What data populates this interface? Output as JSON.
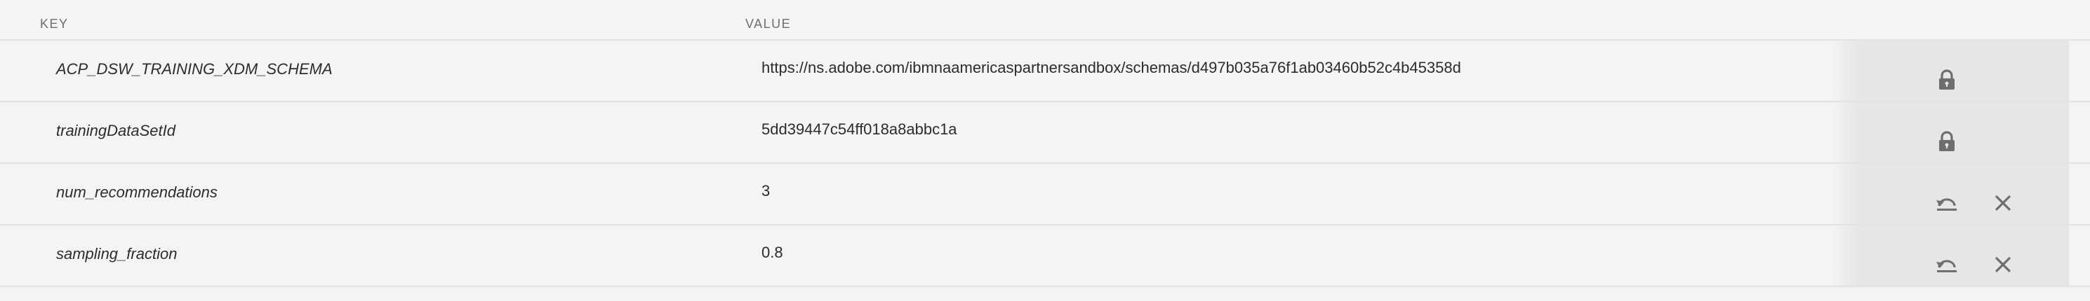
{
  "header": {
    "key_label": "KEY",
    "value_label": "VALUE"
  },
  "rows": [
    {
      "key": "ACP_DSW_TRAINING_XDM_SCHEMA",
      "value": "https://ns.adobe.com/ibmnaamericaspartnersandbox/schemas/d497b035a76f1ab03460b52c4b45358d",
      "locked": true
    },
    {
      "key": "trainingDataSetId",
      "value": "5dd39447c54ff018a8abbc1a",
      "locked": true
    },
    {
      "key": "num_recommendations",
      "value": "3",
      "locked": false
    },
    {
      "key": "sampling_fraction",
      "value": "0.8",
      "locked": false
    }
  ],
  "icons": {
    "lock": "lock-icon",
    "undo": "undo-icon",
    "close": "close-icon"
  },
  "colors": {
    "background": "#f4f4f4",
    "action_panel": "#e6e6e6",
    "icon": "#6e6e6e",
    "divider": "#e2e2e2"
  }
}
